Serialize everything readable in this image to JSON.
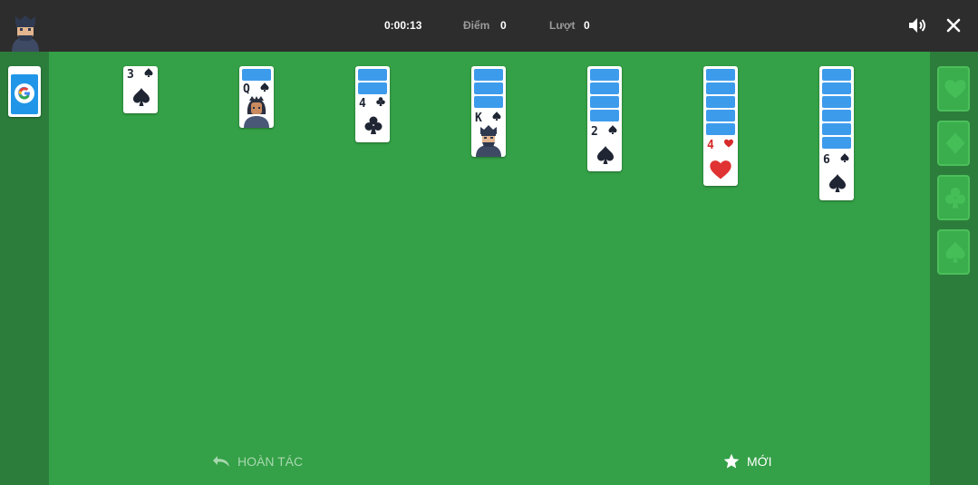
{
  "header": {
    "timer": "0:00:13",
    "score_label": "Điểm",
    "score_value": "0",
    "moves_label": "Lượt",
    "moves_value": "0"
  },
  "actions": {
    "undo_label": "HOÀN TÁC",
    "new_label": "MỚI"
  },
  "tableau": [
    {
      "rank": "3",
      "suit": "spade"
    },
    {
      "rank": "Q",
      "suit": "spade"
    },
    {
      "rank": "4",
      "suit": "club"
    },
    {
      "rank": "K",
      "suit": "spade"
    },
    {
      "rank": "2",
      "suit": "spade"
    },
    {
      "rank": "4",
      "suit": "heart"
    },
    {
      "rank": "6",
      "suit": "spade"
    }
  ],
  "foundations": [
    "heart-icon",
    "diamond-icon",
    "club-icon",
    "spade-icon"
  ],
  "colors": {
    "felt": "#34a047",
    "side_panel": "#2c7d3c",
    "top_bar": "#2d2d2d",
    "card_back": "#3d9bec",
    "red_suit": "#d62b2b",
    "black_suit": "#1f2533"
  }
}
